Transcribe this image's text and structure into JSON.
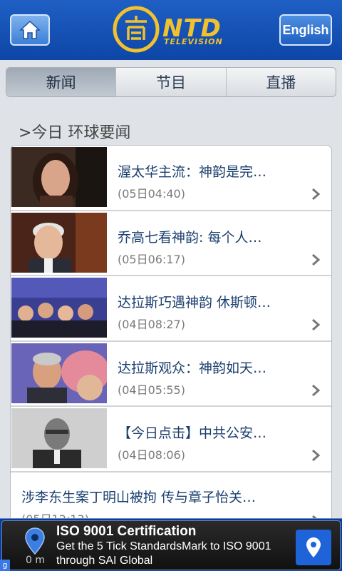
{
  "header": {
    "logo_text": "NTD",
    "logo_sub": "TELEVISION",
    "english_label": "English"
  },
  "tabs": [
    {
      "label": "新闻",
      "active": true
    },
    {
      "label": "节目",
      "active": false
    },
    {
      "label": "直播",
      "active": false
    }
  ],
  "section_title": ">今日 环球要闻",
  "news": [
    {
      "title": "渥太华主流：神韵是完…",
      "time": "(05日04:40)",
      "thumb": "woman-interview-photo"
    },
    {
      "title": "乔高七看神韵: 每个人…",
      "time": "(05日06:17)",
      "thumb": "older-man-interview-photo"
    },
    {
      "title": "达拉斯巧遇神韵 休斯顿…",
      "time": "(04日08:27)",
      "thumb": "audience-group-photo"
    },
    {
      "title": "达拉斯观众：神韵如天…",
      "time": "(04日05:55)",
      "thumb": "couple-interview-photo"
    },
    {
      "title": "【今日点击】中共公安…",
      "time": "(04日08:06)",
      "thumb": "official-speaking-photo"
    },
    {
      "title": "涉李东生案丁明山被拘 传与章子怡关…",
      "time": "(05日12:13)",
      "thumb": ""
    }
  ],
  "ad": {
    "title": "ISO 9001 Certification",
    "line1": "Get the 5 Tick StandardsMark to ISO 9001",
    "line2": "through SAI Global",
    "distance": "0 m",
    "badge": "g"
  },
  "colors": {
    "header_blue": "#0d46a6",
    "logo_gold": "#f2c12e",
    "title_blue": "#1b3f6e"
  }
}
